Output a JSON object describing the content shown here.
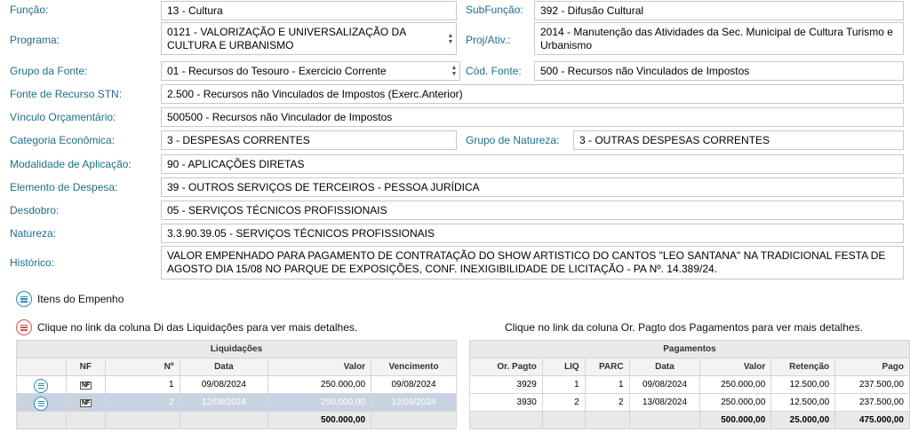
{
  "form": {
    "funcao": {
      "label": "Função:",
      "value": "13 - Cultura"
    },
    "subfuncao": {
      "label": "SubFunção:",
      "value": "392 - Difusão Cultural"
    },
    "programa": {
      "label": "Programa:",
      "value": "0121 - VALORIZAÇÃO E UNIVERSALIZAÇÃO DA CULTURA E URBANISMO"
    },
    "proj_ativ": {
      "label": "Proj/Ativ.:",
      "value": "2014 - Manutenção das Atividades da Sec. Municipal de Cultura Turismo e Urbanismo"
    },
    "grupo_fonte": {
      "label": "Grupo da Fonte:",
      "value": "01 - Recursos do Tesouro - Exercicio Corrente"
    },
    "cod_fonte": {
      "label": "Cód. Fonte:",
      "value": "500 - Recursos não Vinculados de Impostos"
    },
    "fonte_stn": {
      "label": "Fonte de Recurso STN:",
      "value": "2.500 - Recursos não Vinculados de Impostos (Exerc.Anterior)"
    },
    "vinculo": {
      "label": "Vínculo Orçamentário:",
      "value": "500500 - Recursos não Vinculador de Impostos"
    },
    "categoria": {
      "label": "Categoria Econômica:",
      "value": "3 - DESPESAS CORRENTES"
    },
    "grupo_natureza": {
      "label": "Grupo de Natureza:",
      "value": "3 - OUTRAS DESPESAS CORRENTES"
    },
    "modalidade": {
      "label": "Modalidade de Aplicação:",
      "value": "90 - APLICAÇÕES DIRETAS"
    },
    "elemento": {
      "label": "Elemento de Despesa:",
      "value": "39 - OUTROS SERVIÇOS DE TERCEIROS - PESSOA JURÍDICA"
    },
    "desdobro": {
      "label": "Desdobro:",
      "value": "05 - SERVIÇOS TÉCNICOS PROFISSIONAIS"
    },
    "natureza": {
      "label": "Natureza:",
      "value": "3.3.90.39.05 - SERVIÇOS TÉCNICOS PROFISSIONAIS"
    },
    "historico": {
      "label": "Histórico:",
      "value": "VALOR EMPENHADO PARA PAGAMENTO DE CONTRATAÇÃO DO SHOW ARTISTICO DO CANTOS \"LEO SANTANA\" NA TRADICIONAL FESTA DE AGOSTO DIA 15/08 NO PARQUE DE EXPOSIÇÕES, CONF. INEXIGIBILIDADE DE LICITAÇÃO - PA Nº. 14.389/24."
    }
  },
  "sections": {
    "itens_label": "Itens do Empenho",
    "liq_hint": "Clique no link da coluna Di das Liquidações para ver mais detalhes.",
    "pag_hint": "Clique no link da coluna Or. Pagto dos Pagamentos para ver mais detalhes."
  },
  "liquidacoes": {
    "caption": "Liquidações",
    "headers": {
      "nf": "NF",
      "num": "Nº",
      "data": "Data",
      "valor": "Valor",
      "venc": "Vencimento"
    },
    "nf_icon_text": "NF",
    "rows": [
      {
        "num": "1",
        "data": "09/08/2024",
        "valor": "250.000,00",
        "venc": "09/08/2024"
      },
      {
        "num": "2",
        "data": "12/08/2024",
        "valor": "250.000,00",
        "venc": "12/08/2024"
      }
    ],
    "total": "500.000,00"
  },
  "pagamentos": {
    "caption": "Pagamentos",
    "headers": {
      "or": "Or. Pagto",
      "liq": "LIQ",
      "parc": "PARC",
      "data": "Data",
      "valor": "Valor",
      "retencao": "Retenção",
      "pago": "Pago"
    },
    "rows": [
      {
        "or": "3929",
        "liq": "1",
        "parc": "1",
        "data": "09/08/2024",
        "valor": "250.000,00",
        "retencao": "12.500,00",
        "pago": "237.500,00"
      },
      {
        "or": "3930",
        "liq": "2",
        "parc": "2",
        "data": "13/08/2024",
        "valor": "250.000,00",
        "retencao": "12.500,00",
        "pago": "237.500,00"
      }
    ],
    "totals": {
      "valor": "500.000,00",
      "retencao": "25.000,00",
      "pago": "475.000,00"
    }
  },
  "colors": {
    "label": "#1e6e8a",
    "accent_blue": "#2a8ab5",
    "accent_red": "#d9534f",
    "selected_row": "#c9d2e3"
  },
  "icons": {
    "itens": "list-circle-icon",
    "hint": "list-circle-icon",
    "row": "list-circle-icon",
    "nf": "nf-document-icon",
    "spin": "spin-updown-icon"
  }
}
